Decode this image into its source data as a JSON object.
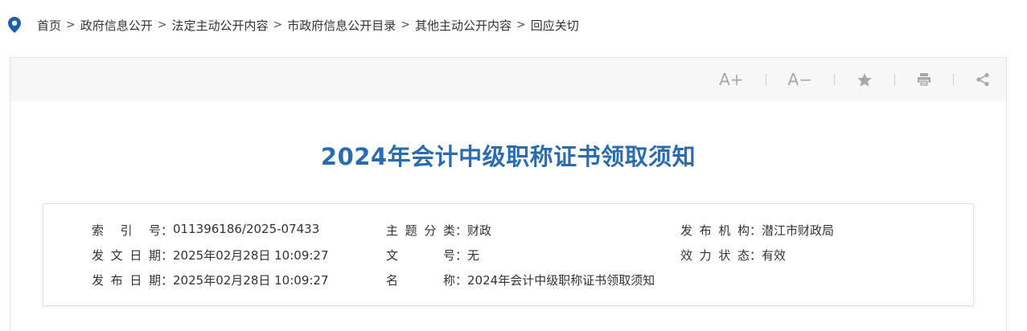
{
  "breadcrumb": {
    "items": [
      "首页",
      "政府信息公开",
      "法定主动公开内容",
      "市政府信息公开目录",
      "其他主动公开内容",
      "回应关切"
    ],
    "separator": ">"
  },
  "toolbar": {
    "font_increase": "A+",
    "font_decrease": "A−",
    "icons": [
      "font-increase-icon",
      "font-decrease-icon",
      "star-icon",
      "print-icon",
      "share-icon"
    ]
  },
  "article": {
    "title": "2024年会计中级职称证书领取须知"
  },
  "meta": {
    "index_label": "索 引 号",
    "index_value": "011396186/2025-07433",
    "topic_label": "主题分类",
    "topic_value": "财政",
    "publisher_label": "发布机构",
    "publisher_value": "潜江市财政局",
    "doc_date_label": "发文日期",
    "doc_date_value": "2025年02月28日 10:09:27",
    "doc_no_label": "文 号",
    "doc_no_value": "无",
    "validity_label": "效力状态",
    "validity_value": "有效",
    "pub_date_label": "发布日期",
    "pub_date_value": "2025年02月28日 10:09:27",
    "name_label": "名 称",
    "name_value": "2024年会计中级职称证书领取须知",
    "colon": "："
  },
  "colors": {
    "title": "#2b6cb0",
    "pin": "#1f5fa8",
    "toolbar_bg": "#f7f7f7",
    "icon": "#a8a8a8"
  }
}
